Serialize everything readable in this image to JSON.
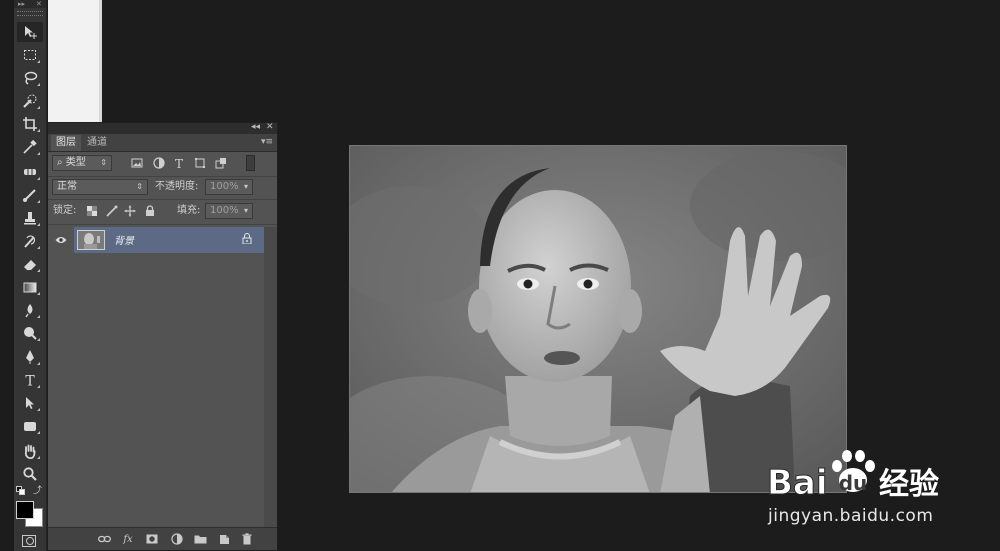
{
  "layers_panel": {
    "tabs": [
      {
        "label": "图层",
        "active": true
      },
      {
        "label": "通道",
        "active": false
      }
    ],
    "filter": {
      "label": "类型"
    },
    "blend_mode": {
      "value": "正常"
    },
    "opacity": {
      "label": "不透明度:",
      "value": "100%"
    },
    "lock": {
      "label": "锁定:"
    },
    "fill": {
      "label": "填充:",
      "value": "100%"
    },
    "layers": [
      {
        "name": "背景",
        "visible": true,
        "locked": true,
        "selected": true
      }
    ]
  },
  "tools": [
    "move-tool-icon",
    "marquee-tool-icon",
    "lasso-tool-icon",
    "quick-select-tool-icon",
    "crop-tool-icon",
    "eyedropper-tool-icon",
    "healing-brush-tool-icon",
    "brush-tool-icon",
    "clone-stamp-tool-icon",
    "history-brush-tool-icon",
    "eraser-tool-icon",
    "gradient-tool-icon",
    "blur-tool-icon",
    "dodge-tool-icon",
    "pen-tool-icon",
    "type-tool-icon",
    "path-select-tool-icon",
    "rectangle-tool-icon",
    "hand-tool-icon",
    "zoom-tool-icon"
  ],
  "colors": {
    "foreground": "#000000",
    "background": "#ffffff",
    "selected_layer": "#5d6a85"
  },
  "watermark": {
    "logo_text_latin": "Bai",
    "logo_text_cn": "经验",
    "url": "jingyan.baidu.com"
  }
}
